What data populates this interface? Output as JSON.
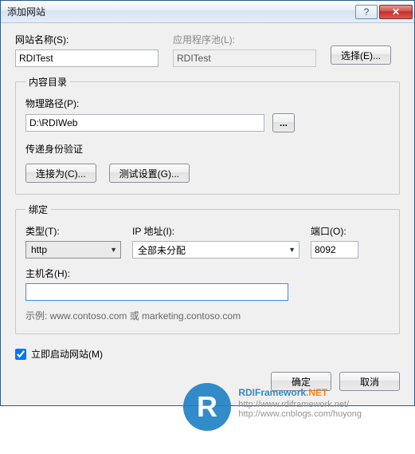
{
  "window": {
    "title": "添加网站"
  },
  "site": {
    "name_label": "网站名称(S):",
    "name_value": "RDITest",
    "pool_label": "应用程序池(L):",
    "pool_value": "RDITest",
    "select_btn": "选择(E)..."
  },
  "content": {
    "legend": "内容目录",
    "phys_label": "物理路径(P):",
    "phys_value": "D:\\RDIWeb",
    "browse_btn": "...",
    "auth_label": "传递身份验证",
    "connect_as_btn": "连接为(C)...",
    "test_btn": "测试设置(G)..."
  },
  "binding": {
    "legend": "绑定",
    "type_label": "类型(T):",
    "type_value": "http",
    "ip_label": "IP 地址(I):",
    "ip_value": "全部未分配",
    "port_label": "端口(O):",
    "port_value": "8092",
    "host_label": "主机名(H):",
    "host_value": "",
    "hint": "示例: www.contoso.com 或 marketing.contoso.com"
  },
  "start_now_label": "立即启动网站(M)",
  "start_now_checked": true,
  "footer": {
    "ok": "确定",
    "cancel": "取消"
  },
  "watermark": {
    "brand": "RDIFramework",
    "suffix": ".NET",
    "url1": "http://www.rdiframework.net/",
    "url2": "http://www.cnblogs.com/huyong"
  }
}
